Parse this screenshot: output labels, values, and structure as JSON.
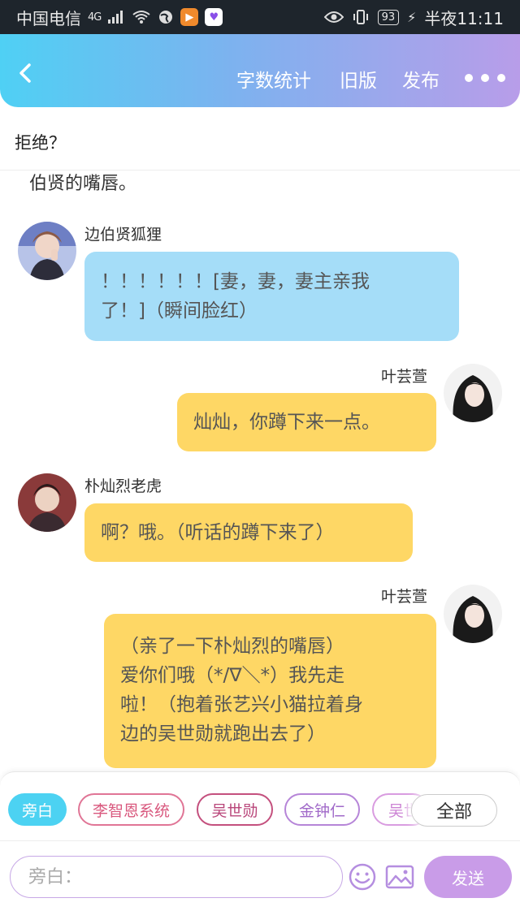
{
  "status_bar": {
    "carrier": "中国电信",
    "network": "4G",
    "battery": "93",
    "time": "半夜11:11"
  },
  "header": {
    "word_count": "字数统计",
    "old_version": "旧版",
    "publish": "发布"
  },
  "title": "拒绝？",
  "partial_text": "伯贤的嘴唇。",
  "messages": [
    {
      "speaker": "边伯贤狐狸",
      "text_lines": [
        "！！！！！！[妻，妻，妻主亲我",
        "了！]（瞬间脸红）"
      ],
      "side": "left",
      "color": "#a5ddf8"
    },
    {
      "speaker": "叶芸萱",
      "text_lines": [
        "灿灿，你蹲下来一点。"
      ],
      "side": "right",
      "color": "#fed765"
    },
    {
      "speaker": "朴灿烈老虎",
      "text_lines": [
        "啊？哦。（听话的蹲下来了）"
      ],
      "side": "left",
      "color": "#fed765"
    },
    {
      "speaker": "叶芸萱",
      "text_lines": [
        "（亲了一下朴灿烈的嘴唇）",
        "爱你们哦（*/∇＼*）我先走",
        "啦！（抱着张艺兴小猫拉着身",
        "边的吴世勋就跑出去了）"
      ],
      "side": "right",
      "color": "#fed765"
    }
  ],
  "role_chips": [
    "旁白",
    "李智恩系统",
    "吴世勋",
    "金钟仁",
    "吴世"
  ],
  "all_button": "全部",
  "input": {
    "placeholder": "旁白："
  },
  "send_label": "发送",
  "colors": {
    "header_start": "#4fd0f4",
    "header_end": "#b89de9",
    "accent": "#4cd2f2",
    "send": "#c99ce8"
  }
}
